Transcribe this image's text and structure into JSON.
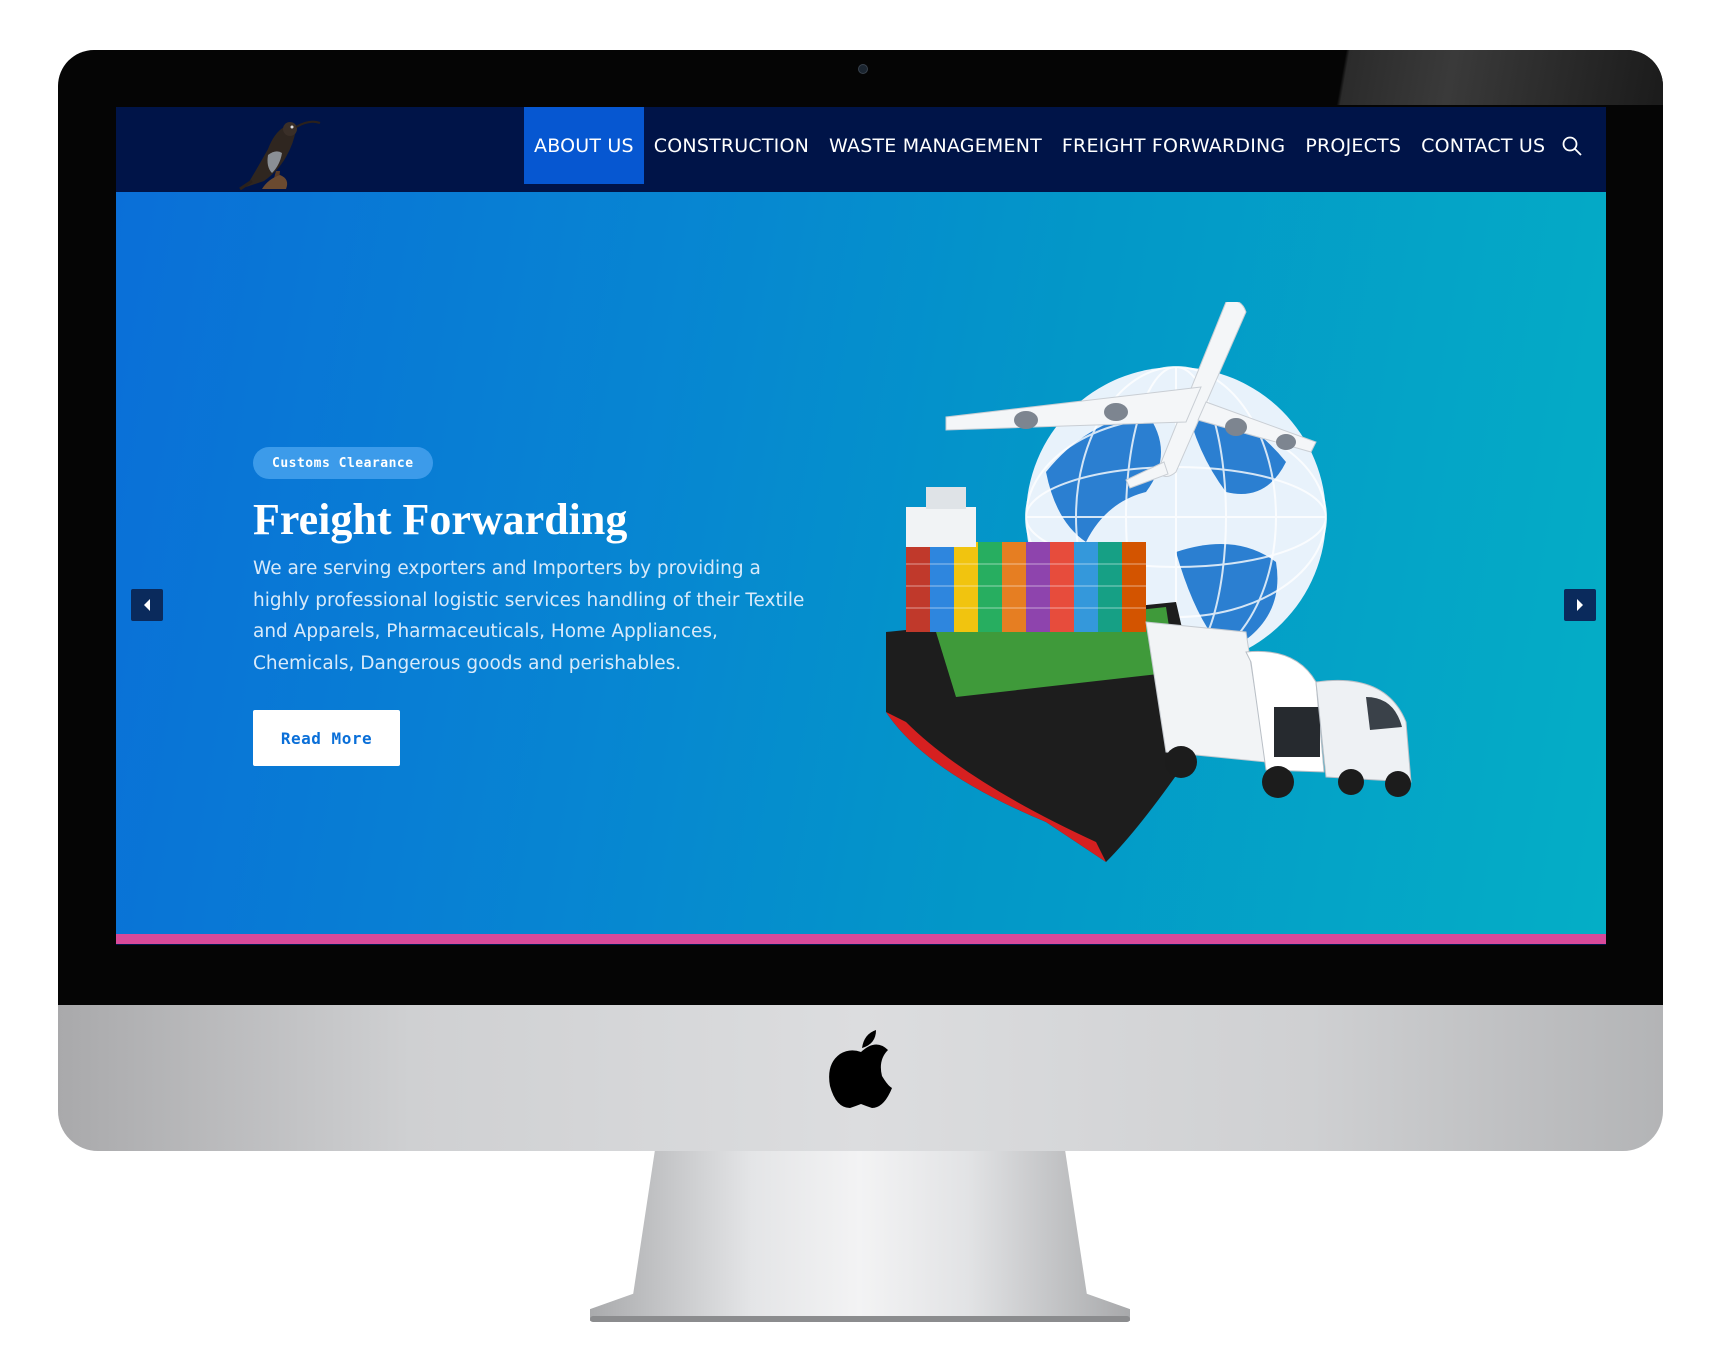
{
  "nav": {
    "items": [
      {
        "label": "ABOUT US",
        "active": true
      },
      {
        "label": "CONSTRUCTION",
        "active": false
      },
      {
        "label": "WASTE MANAGEMENT",
        "active": false
      },
      {
        "label": "FREIGHT FORWARDING",
        "active": false
      },
      {
        "label": "PROJECTS",
        "active": false
      },
      {
        "label": "CONTACT US",
        "active": false
      }
    ],
    "search_icon": "search-icon"
  },
  "hero": {
    "tag": "Customs Clearance",
    "title": "Freight Forwarding",
    "text": "We are serving exporters and Importers by providing a highly professional logistic services handling of their Textile and Apparels, Pharmaceuticals, Home Appliances, Chemicals, Dangerous goods and perishables.",
    "cta": "Read More",
    "prev_icon": "caret-left-icon",
    "next_icon": "caret-right-icon"
  },
  "colors": {
    "navbar": "#001448",
    "active_nav": "#0657d1",
    "hero_start": "#0a6fd8",
    "hero_end": "#04aec6",
    "accent_bar": "#d84a9a"
  }
}
